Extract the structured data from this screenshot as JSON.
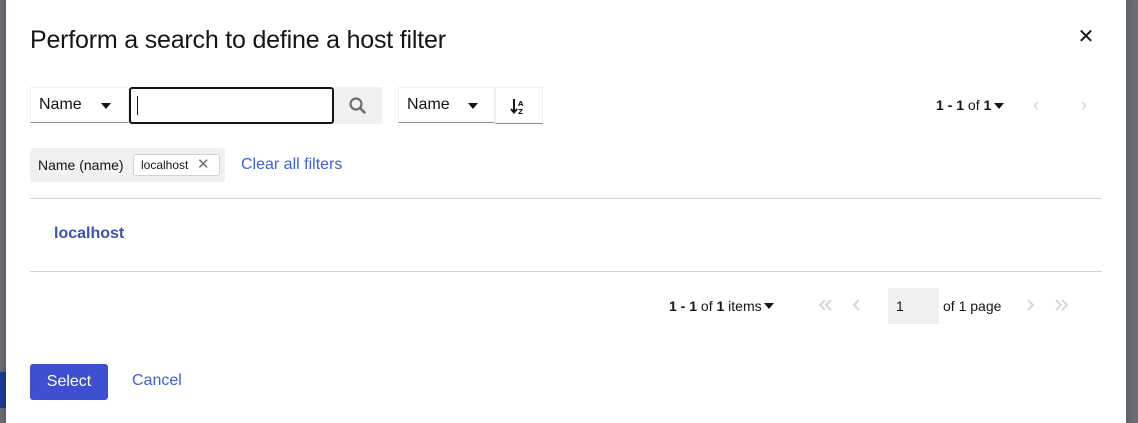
{
  "modal": {
    "title": "Perform a search to define a host filter",
    "close_icon": "close-icon"
  },
  "toolbar": {
    "filter_attribute": "Name",
    "search_value": "",
    "search_icon": "search-icon",
    "sort_attribute": "Name",
    "sort_icon": "sort-alpha-down-icon"
  },
  "pagination_top": {
    "range": "1 - 1",
    "of_label": "of",
    "total": "1"
  },
  "chips": {
    "group_label": "Name (name)",
    "items": [
      "localhost"
    ],
    "clear_label": "Clear all filters"
  },
  "results": [
    {
      "name": "localhost"
    }
  ],
  "pagination_bottom": {
    "range": "1 - 1",
    "of_label": "of",
    "total": "1",
    "items_label": "items",
    "page_value": "1",
    "page_suffix": "of 1 page"
  },
  "footer": {
    "select_label": "Select",
    "cancel_label": "Cancel"
  },
  "colors": {
    "primary": "#3e4fcf",
    "link": "#3e5fd6"
  }
}
